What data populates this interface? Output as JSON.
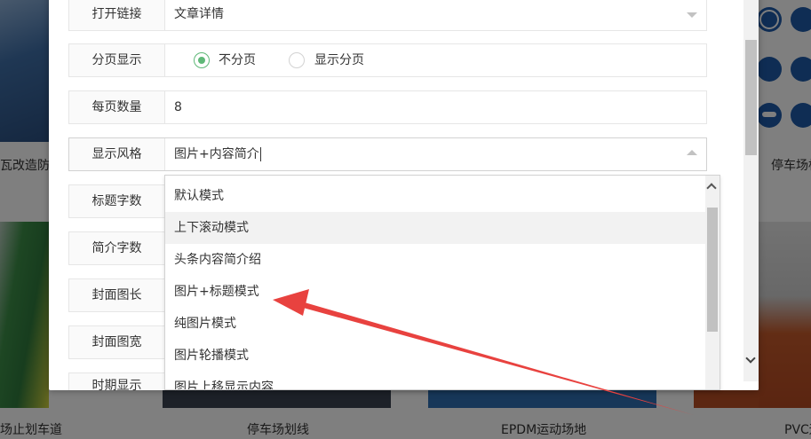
{
  "background": {
    "captions": [
      "瓦改造防腐",
      "停车场标",
      "场止划车道",
      "停车场划线",
      "EPDM运动场地",
      "PVC运"
    ]
  },
  "form": {
    "rows": [
      {
        "label": "打开链接",
        "value": "文章详情"
      },
      {
        "label": "分页显示",
        "radio": {
          "option1": "不分页",
          "option2": "显示分页",
          "selected": "不分页"
        }
      },
      {
        "label": "每页数量",
        "value": "8"
      },
      {
        "label": "显示风格",
        "value": "图片+内容简介"
      },
      {
        "label": "标题字数"
      },
      {
        "label": "简介字数"
      },
      {
        "label": "封面图长"
      },
      {
        "label": "封面图宽"
      },
      {
        "label": "时期显示"
      }
    ]
  },
  "dropdown": {
    "options": [
      "默认模式",
      "上下滚动模式",
      "头条内容简介绍",
      "图片+标题模式",
      "纯图片模式",
      "图片轮播模式",
      "图片上移显示内容"
    ],
    "hover_index": 1
  },
  "colors": {
    "radio_checked": "#5FB878",
    "annotation_arrow": "#e8423f"
  }
}
